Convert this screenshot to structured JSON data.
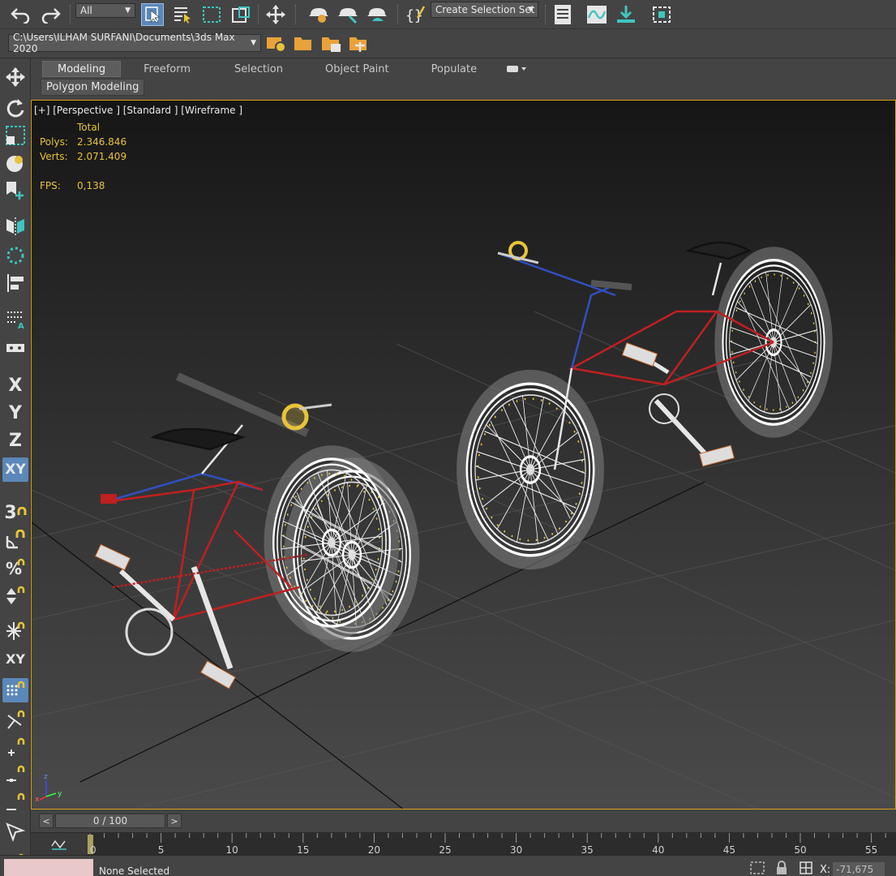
{
  "toolbar": {
    "undo_icon": "undo-icon",
    "redo_icon": "redo-icon",
    "selection_filter": "All",
    "named_selection": "Create Selection Set"
  },
  "project": {
    "path": "C:\\Users\\ILHAM SURFANI\\Documents\\3ds Max 2020"
  },
  "ribbon": {
    "tabs": [
      "Modeling",
      "Freeform",
      "Selection",
      "Object Paint",
      "Populate"
    ],
    "active_tab": "Modeling",
    "panel": "Polygon Modeling"
  },
  "left_strip": {
    "axis_x": "X",
    "axis_y": "Y",
    "axis_z": "Z",
    "axis_xy": "XY",
    "snap_3": "3",
    "xy_small": "XY"
  },
  "viewport": {
    "label": "[+] [Perspective ] [Standard ] [Wireframe ]",
    "stats": {
      "header": "Total",
      "polys_label": "Polys:",
      "polys_value": "2.346.846",
      "verts_label": "Verts:",
      "verts_value": "2.071.409",
      "fps_label": "FPS:",
      "fps_value": "0,138"
    },
    "gizmo": {
      "x": "x",
      "y": "y",
      "z": "z"
    }
  },
  "timeline": {
    "prev": "<",
    "next": ">",
    "frame_display": "0 / 100",
    "ticks": [
      "0",
      "5",
      "10",
      "15",
      "20",
      "25",
      "30",
      "35",
      "40",
      "45",
      "50",
      "55"
    ]
  },
  "status": {
    "selection": "None Selected",
    "x_label": "X:",
    "x_value": "-71,675"
  },
  "colors": {
    "viewport_border": "#d4a017",
    "stats_text": "#e8c33a",
    "accent_blue": "#5b88b8",
    "teal_icon": "#3fc6c0"
  }
}
